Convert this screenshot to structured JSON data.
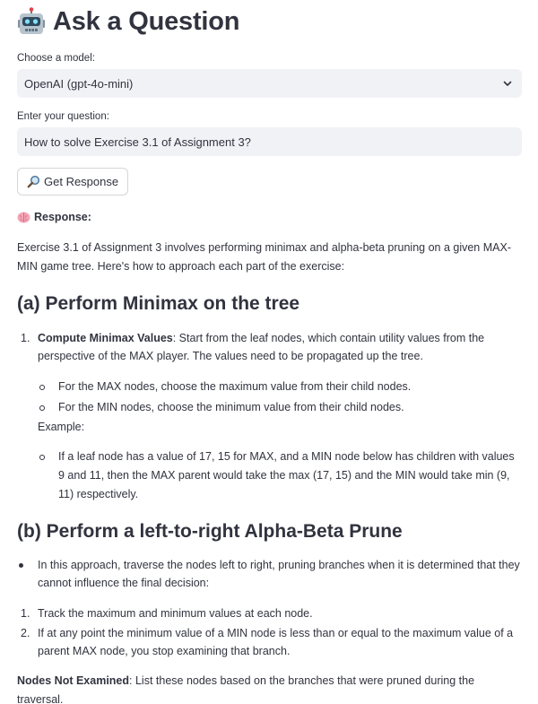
{
  "header": {
    "title": "Ask a Question",
    "icon": "robot-icon"
  },
  "model": {
    "label": "Choose a model:",
    "selected": "OpenAI (gpt-4o-mini)"
  },
  "question": {
    "label": "Enter your question:",
    "value": "How to solve Exercise 3.1 of Assignment 3?"
  },
  "button": {
    "label": "Get Response",
    "icon": "magnifier-icon"
  },
  "response": {
    "label": "Response:",
    "icon": "brain-icon",
    "intro": "Exercise 3.1 of Assignment 3 involves performing minimax and alpha-beta pruning on a given MAX-MIN game tree. Here's how to approach each part of the exercise:",
    "section_a": {
      "heading": "(a) Perform Minimax on the tree",
      "item1_num": "1.",
      "item1_bold": "Compute Minimax Values",
      "item1_text": ": Start from the leaf nodes, which contain utility values from the perspective of the MAX player. The values need to be propagated up the tree.",
      "sub1": "For the MAX nodes, choose the maximum value from their child nodes.",
      "sub2": "For the MIN nodes, choose the minimum value from their child nodes.",
      "example_label": "Example:",
      "example_item": "If a leaf node has a value of 17, 15 for MAX, and a MIN node below has children with values 9 and 11, then the MAX parent would take the max (17, 15) and the MIN would take min (9, 11) respectively."
    },
    "section_b": {
      "heading": "(b) Perform a left-to-right Alpha-Beta Prune",
      "bullet": "In this approach, traverse the nodes left to right, pruning branches when it is determined that they cannot influence the final decision:",
      "step1_num": "1.",
      "step1": "Track the maximum and minimum values at each node.",
      "step2_num": "2.",
      "step2": "If at any point the minimum value of a MIN node is less than or equal to the maximum value of a parent MAX node, you stop examining that branch."
    },
    "nodes_bold": "Nodes Not Examined",
    "nodes_text": ": List these nodes based on the branches that were pruned during the traversal."
  }
}
